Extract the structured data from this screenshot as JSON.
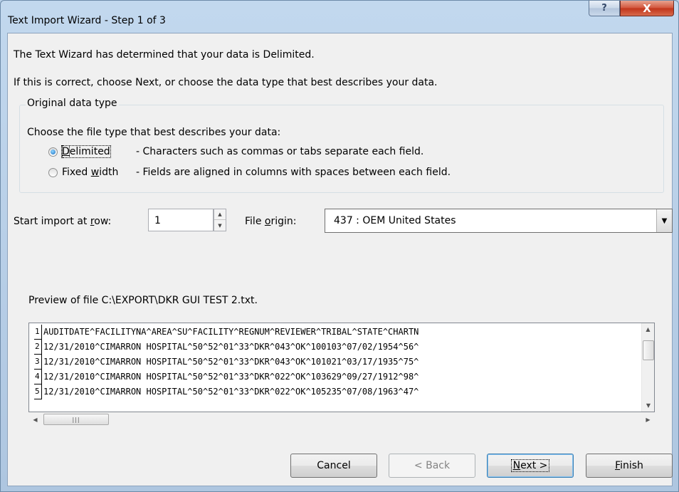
{
  "window": {
    "title": "Text Import Wizard - Step 1 of 3",
    "help_glyph": "?",
    "close_glyph": "X"
  },
  "intro": {
    "line1": "The Text Wizard has determined that your data is Delimited.",
    "line2": "If this is correct, choose Next, or choose the data type that best describes your data."
  },
  "original_data_type": {
    "group_label": "Original data type",
    "prompt": "Choose the file type that best describes your data:",
    "options": [
      {
        "label_pre": "",
        "label_key": "D",
        "label_post": "elimited",
        "description": "- Characters such as commas or tabs separate each field.",
        "selected": true
      },
      {
        "label_pre": "Fixed ",
        "label_key": "w",
        "label_post": "idth",
        "description": "- Fields are aligned in columns with spaces between each field.",
        "selected": false
      }
    ]
  },
  "start_row": {
    "label_pre": "Start import at ",
    "label_key": "r",
    "label_post": "ow:",
    "value": "1"
  },
  "file_origin": {
    "label_pre": "File ",
    "label_key": "o",
    "label_post": "rigin:",
    "value": "437 : OEM United States"
  },
  "preview": {
    "label": "Preview of file C:\\EXPORT\\DKR GUI TEST 2.txt.",
    "lines": [
      {
        "num": "1",
        "text": "AUDITDATE^FACILITYNA^AREA^SU^FACILITY^REGNUM^REVIEWER^TRIBAL^STATE^CHARTN"
      },
      {
        "num": "2",
        "text": "12/31/2010^CIMARRON HOSPITAL^50^52^01^33^DKR^043^OK^100103^07/02/1954^56^"
      },
      {
        "num": "3",
        "text": "12/31/2010^CIMARRON HOSPITAL^50^52^01^33^DKR^043^OK^101021^03/17/1935^75^"
      },
      {
        "num": "4",
        "text": "12/31/2010^CIMARRON HOSPITAL^50^52^01^33^DKR^022^OK^103629^09/27/1912^98^"
      },
      {
        "num": "5",
        "text": "12/31/2010^CIMARRON HOSPITAL^50^52^01^33^DKR^022^OK^105235^07/08/1963^47^"
      }
    ]
  },
  "buttons": {
    "cancel": "Cancel",
    "back": "< Back",
    "next_key": "N",
    "next_post": "ext >",
    "finish_key": "F",
    "finish_post": "inish"
  }
}
